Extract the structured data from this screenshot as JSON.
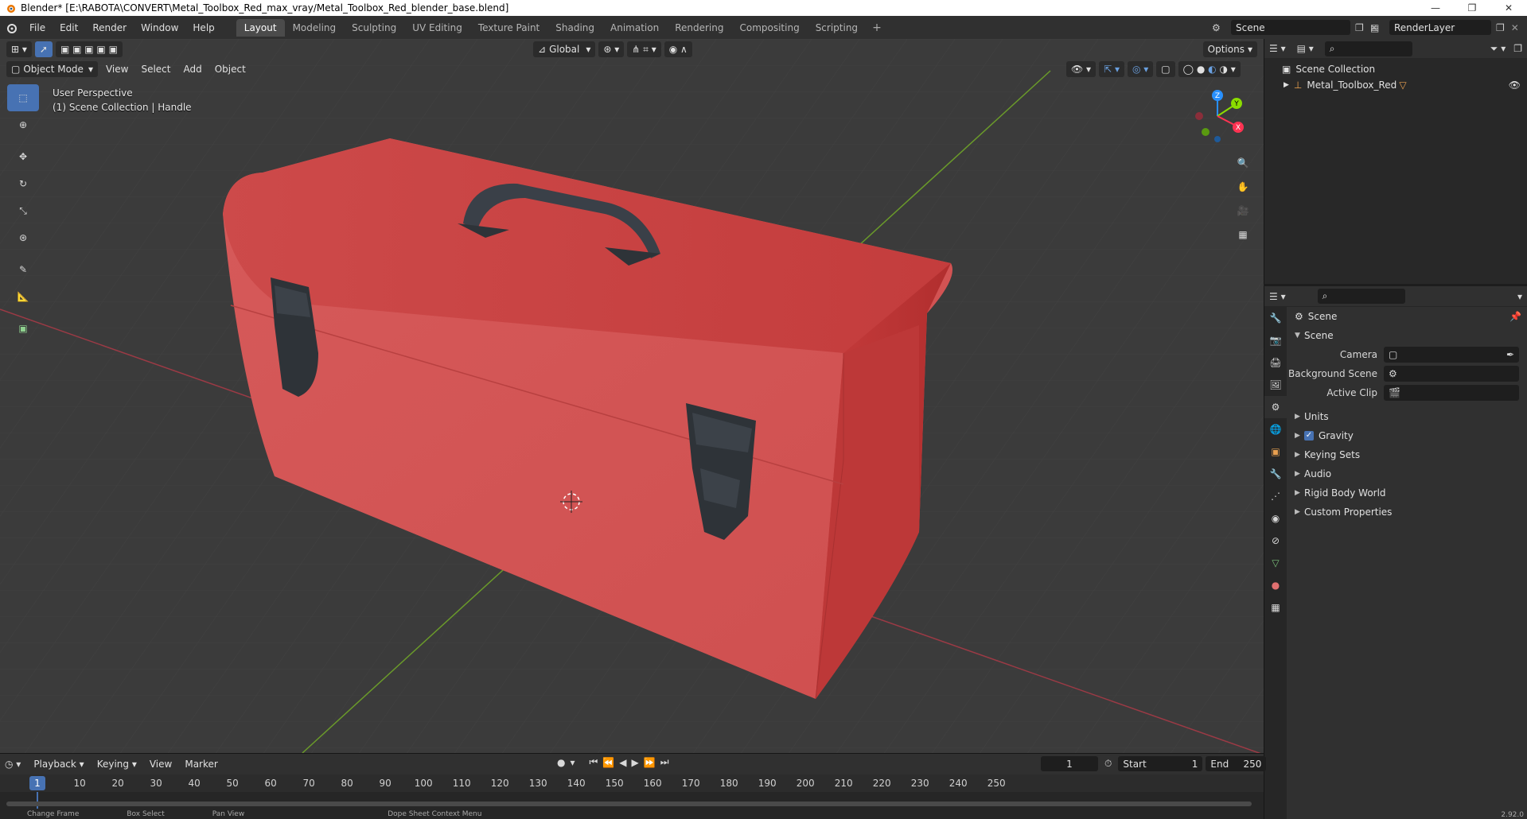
{
  "window": {
    "title": "Blender* [E:\\RABOTA\\CONVERT\\Metal_Toolbox_Red_max_vray/Metal_Toolbox_Red_blender_base.blend]"
  },
  "menu": [
    "File",
    "Edit",
    "Render",
    "Window",
    "Help"
  ],
  "workspaces": [
    "Layout",
    "Modeling",
    "Sculpting",
    "UV Editing",
    "Texture Paint",
    "Shading",
    "Animation",
    "Rendering",
    "Compositing",
    "Scripting"
  ],
  "workspace_add": "+",
  "scene_name": "Scene",
  "render_layer": "RenderLayer",
  "viewport": {
    "transform_orientation": "Global",
    "options_label": "Options",
    "mode": "Object Mode",
    "header_menus": [
      "View",
      "Select",
      "Add",
      "Object"
    ],
    "perspective": "User Perspective",
    "collection_info": "(1) Scene Collection | Handle",
    "gizmo": {
      "x": "X",
      "y": "Y",
      "z": "Z"
    }
  },
  "outliner": {
    "root": "Scene Collection",
    "items": [
      "Metal_Toolbox_Red"
    ]
  },
  "properties": {
    "context": "Scene",
    "panel_scene": "Scene",
    "fields": {
      "camera": "Camera",
      "background_scene": "Background Scene",
      "active_clip": "Active Clip"
    },
    "panels": [
      "Units",
      "Gravity",
      "Keying Sets",
      "Audio",
      "Rigid Body World",
      "Custom Properties"
    ]
  },
  "timeline": {
    "menus": [
      "Playback",
      "Keying",
      "View",
      "Marker"
    ],
    "current_frame": "1",
    "start_label": "Start",
    "start": "1",
    "end_label": "End",
    "end": "250",
    "ruler": [
      "1",
      "10",
      "20",
      "30",
      "40",
      "50",
      "60",
      "70",
      "80",
      "90",
      "100",
      "110",
      "120",
      "130",
      "140",
      "150",
      "160",
      "170",
      "180",
      "190",
      "200",
      "210",
      "220",
      "230",
      "240",
      "250"
    ]
  },
  "status_bar": [
    "Change Frame",
    "Box Select",
    "Pan View",
    "Dope Sheet Context Menu",
    "2.92.0"
  ],
  "colors": {
    "accent": "#4772b3",
    "toolbox_red": "#cc4444",
    "x_axis": "#ff3352",
    "y_axis": "#8bdc00",
    "z_axis": "#2890ff"
  }
}
